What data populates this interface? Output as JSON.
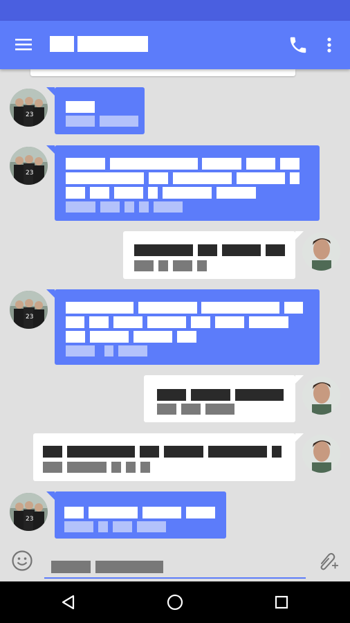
{
  "colors": {
    "status_bar": "#4a5fe0",
    "toolbar": "#5c7cfa",
    "incoming_bubble": "#5c7cfa",
    "outgoing_bubble": "#ffffff",
    "chat_background": "#e0e0e0",
    "input_underline": "#5c7cfa",
    "nav_bar": "#000000"
  },
  "toolbar": {
    "menu_icon": "hamburger-menu-icon",
    "title": "",
    "call_icon": "phone-icon",
    "overflow_icon": "more-vert-icon"
  },
  "messages": [
    {
      "direction": "incoming",
      "avatar": "contact-avatar",
      "text": "",
      "meta": ""
    },
    {
      "direction": "incoming",
      "avatar": "contact-avatar",
      "text": "",
      "meta": ""
    },
    {
      "direction": "outgoing",
      "avatar": "self-avatar",
      "text": "",
      "meta": ""
    },
    {
      "direction": "incoming",
      "avatar": "contact-avatar",
      "text": "",
      "meta": ""
    },
    {
      "direction": "outgoing",
      "avatar": "self-avatar",
      "text": "",
      "meta": ""
    },
    {
      "direction": "outgoing",
      "avatar": "self-avatar",
      "text": "",
      "meta": ""
    },
    {
      "direction": "incoming",
      "avatar": "contact-avatar",
      "text": "",
      "meta": ""
    }
  ],
  "composer": {
    "emoji_icon": "emoji-icon",
    "placeholder": "",
    "attach_icon": "attach-add-icon"
  },
  "navigation": {
    "back_icon": "back-triangle-icon",
    "home_icon": "home-circle-icon",
    "recents_icon": "recents-square-icon"
  }
}
